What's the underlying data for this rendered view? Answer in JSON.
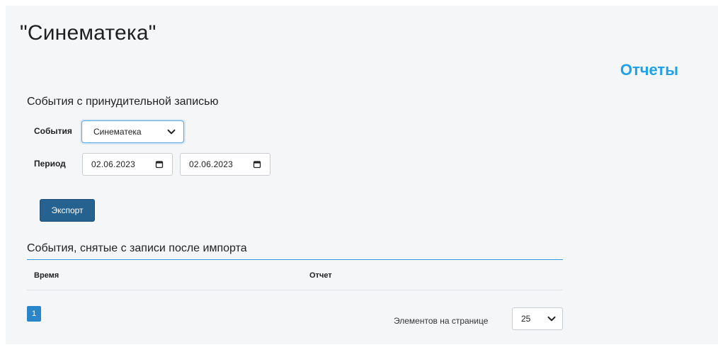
{
  "header": {
    "app_title": "\"Синематека\"",
    "reports_link": "Отчеты"
  },
  "forced_recording": {
    "section_title": "События с принудительной записью",
    "events_label": "События",
    "events_selected": "Синематека",
    "period_label": "Период",
    "date_from": "02.06.2023",
    "date_to": "02.06.2023",
    "export_label": "Экспорт"
  },
  "removed_events": {
    "section_title": "События, снятые с записи после импорта",
    "columns": [
      "Время",
      "Отчет"
    ],
    "rows": []
  },
  "pagination": {
    "current_page": "1",
    "per_page_label": "Элементов на странице",
    "per_page_value": "25"
  },
  "colors": {
    "accent": "#1fa2ea",
    "primary_button": "#26628f",
    "page_button": "#2a86c8",
    "underline": "#3a9ad9"
  },
  "icons": {
    "select_chevron": "chevron-down-icon",
    "date_picker": "calendar-icon"
  }
}
